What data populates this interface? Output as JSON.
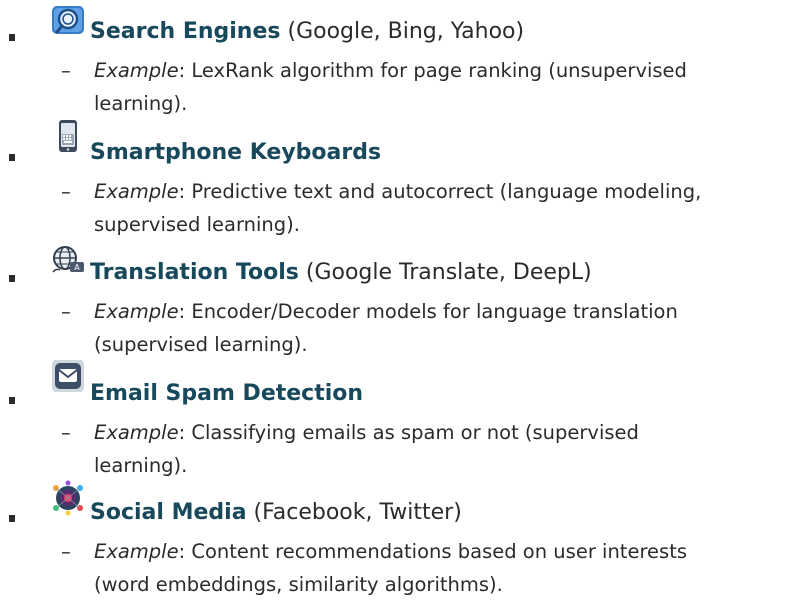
{
  "items": [
    {
      "title": "Search Engines",
      "paren": "(Google, Bing, Yahoo)",
      "icon": "search-magnifier-icon",
      "example_label": "Example",
      "line1": ": LexRank algorithm for page ranking (unsupervised",
      "line2": "learning)."
    },
    {
      "title": "Smartphone Keyboards",
      "paren": "",
      "icon": "smartphone-icon",
      "example_label": "Example",
      "line1": ": Predictive text and autocorrect (language modeling,",
      "line2": "supervised learning)."
    },
    {
      "title": "Translation Tools",
      "paren": "(Google Translate, DeepL)",
      "icon": "translation-globe-icon",
      "example_label": "Example",
      "line1": ": Encoder/Decoder models for language translation",
      "line2": "(supervised learning)."
    },
    {
      "title": "Email Spam Detection",
      "paren": "",
      "icon": "envelope-icon",
      "example_label": "Example",
      "line1": ": Classifying emails as spam or not (supervised",
      "line2": "learning)."
    },
    {
      "title": "Social Media",
      "paren": "(Facebook, Twitter)",
      "icon": "social-network-icon",
      "example_label": "Example",
      "line1": ": Content recommendations based on user interests",
      "line2": "(word embeddings, similarity algorithms)."
    }
  ],
  "dash": "–"
}
